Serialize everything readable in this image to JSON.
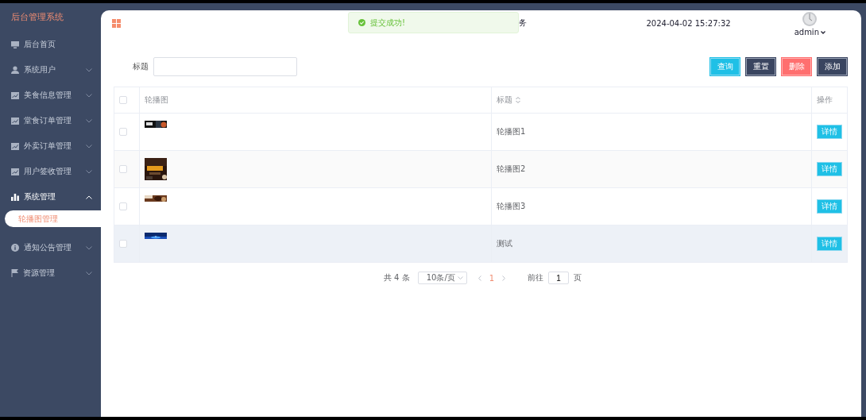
{
  "app_title": "后台管理系统",
  "sidebar": {
    "items": [
      {
        "label": "后台首页"
      },
      {
        "label": "系统用户",
        "expanded": false
      },
      {
        "label": "美食信息管理",
        "expanded": false
      },
      {
        "label": "堂食订单管理",
        "expanded": false
      },
      {
        "label": "外卖订单管理",
        "expanded": false
      },
      {
        "label": "用户签收管理",
        "expanded": false
      },
      {
        "label": "系统管理",
        "expanded": true,
        "children": [
          {
            "label": "轮播图管理",
            "selected": true
          }
        ]
      },
      {
        "label": "通知公告管理",
        "expanded": false
      },
      {
        "label": "资源管理",
        "expanded": false
      }
    ]
  },
  "header": {
    "title": "务",
    "datetime": "2024-04-02 15:27:32",
    "user": "admin"
  },
  "toast": {
    "kind": "success",
    "message": "提交成功!"
  },
  "search": {
    "label": "标题"
  },
  "buttons": [
    {
      "label": "查询",
      "kind": "primary"
    },
    {
      "label": "重置",
      "kind": "dark"
    },
    {
      "label": "删除",
      "kind": "danger"
    },
    {
      "label": "添加",
      "kind": "dark"
    }
  ],
  "table": {
    "header_checked": false,
    "columns": [
      {
        "label": "轮播图",
        "sortable": false
      },
      {
        "label": "标题",
        "sortable": true
      },
      {
        "label": "操作",
        "sortable": false
      }
    ],
    "rows": [
      {
        "checked": false,
        "title": "轮播图1",
        "action": "详情",
        "highlighted": false
      },
      {
        "checked": false,
        "title": "轮播图2",
        "action": "详情",
        "highlighted": false
      },
      {
        "checked": false,
        "title": "轮播图3",
        "action": "详情",
        "highlighted": false
      },
      {
        "checked": false,
        "title": "测试",
        "action": "详情",
        "highlighted": true
      }
    ]
  },
  "pagination": {
    "total": "共 4 条",
    "page_size": "10条/页",
    "pages": [
      {
        "label": "1",
        "selected": true
      }
    ],
    "jump_label": "前往",
    "jump_value": "1",
    "jump_unit": "页"
  }
}
